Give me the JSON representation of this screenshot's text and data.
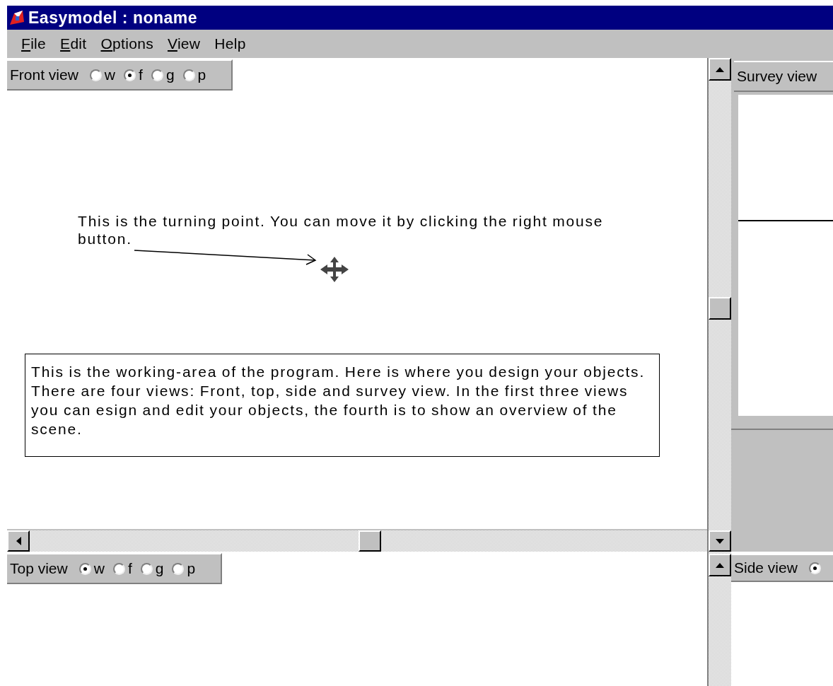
{
  "window": {
    "title": "Easymodel : noname"
  },
  "menu": [
    {
      "label": "File",
      "mnemonic": true
    },
    {
      "label": "Edit",
      "mnemonic": true
    },
    {
      "label": "Options",
      "mnemonic": true
    },
    {
      "label": "View",
      "mnemonic": true
    },
    {
      "label": "Help",
      "mnemonic": false
    }
  ],
  "front_view": {
    "label": "Front view",
    "radios": [
      {
        "label": "w",
        "selected": false
      },
      {
        "label": "f",
        "selected": true
      },
      {
        "label": "g",
        "selected": false
      },
      {
        "label": "p",
        "selected": false
      }
    ],
    "callout": "This is the turning point. You can move it by clicking the right mouse button.",
    "note": "This is the working-area of the program. Here is where you design your objects. There are four views: Front, top, side and survey view. In the first three views you can esign and edit your objects, the fourth is to show an overview of the scene."
  },
  "survey_view": {
    "label": "Survey view"
  },
  "top_view": {
    "label": "Top view",
    "radios": [
      {
        "label": "w",
        "selected": true
      },
      {
        "label": "f",
        "selected": false
      },
      {
        "label": "g",
        "selected": false
      },
      {
        "label": "p",
        "selected": false
      }
    ]
  },
  "side_view": {
    "label": "Side view",
    "radios": [
      {
        "selected": true
      }
    ]
  }
}
